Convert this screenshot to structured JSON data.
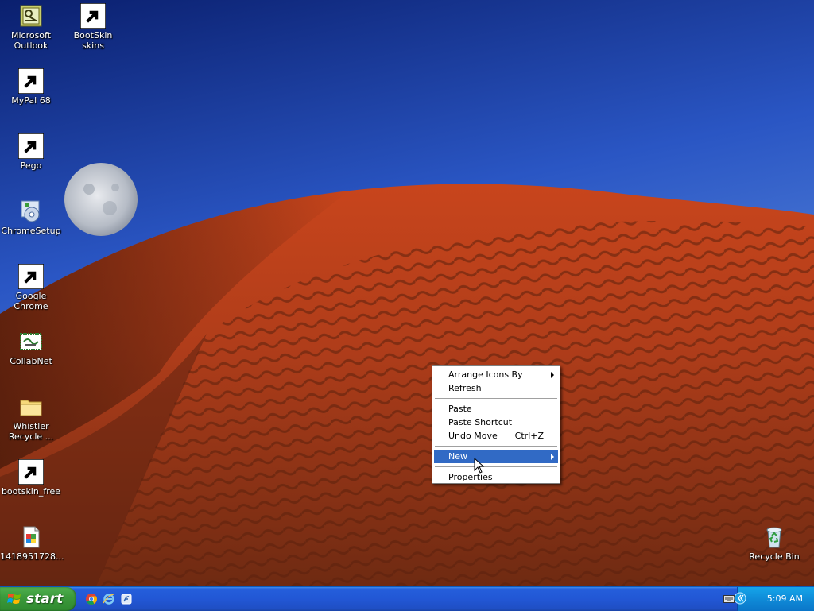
{
  "desktop": {
    "icons": [
      {
        "label": "Microsoft\nOutlook",
        "icon": "outlook-icon"
      },
      {
        "label": "BootSkin skins",
        "icon": "folder-icon"
      },
      {
        "label": "MyPal 68",
        "icon": "mypal-icon"
      },
      {
        "label": "Pego",
        "icon": "pego-icon"
      },
      {
        "label": "ChromeSetup",
        "icon": "chrome-setup-icon"
      },
      {
        "label": "Google Chrome",
        "icon": "chrome-icon"
      },
      {
        "label": "CollabNet",
        "icon": "collabnet-icon"
      },
      {
        "label": "Whistler\nRecycle ...",
        "icon": "folder-icon"
      },
      {
        "label": "bootskin_free",
        "icon": "bootskin-icon"
      },
      {
        "label": "1418951728...",
        "icon": "image-file-icon"
      },
      {
        "label": "Recycle Bin",
        "icon": "recycle-bin-icon"
      }
    ]
  },
  "context_menu": {
    "arrange_icons_by": "Arrange Icons By",
    "refresh": "Refresh",
    "paste": "Paste",
    "paste_shortcut": "Paste Shortcut",
    "undo_move": "Undo Move",
    "undo_move_shortcut": "Ctrl+Z",
    "new": "New",
    "properties": "Properties",
    "highlighted_item": "New",
    "highlight_color": "#316ac5"
  },
  "taskbar": {
    "start_label": "start",
    "quick_launch": [
      "chrome-icon",
      "internet-explorer-icon",
      "desktop-switch-icon"
    ],
    "clock": "5:09 AM",
    "colors": {
      "taskbar": "#245edb",
      "start": "#3c9a3c",
      "tray": "#0f8bd8"
    }
  }
}
